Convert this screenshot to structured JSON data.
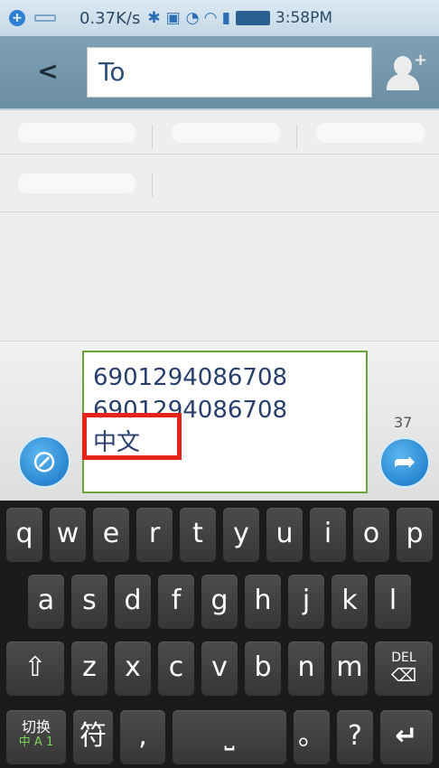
{
  "status_bar": {
    "speed": "0.37K/s",
    "time": "3:58PM",
    "icons": [
      "plus-circle-icon",
      "keyboard-icon",
      "bluetooth-icon",
      "vibrate-icon",
      "sync-icon",
      "wifi-icon",
      "signal-icon",
      "battery-icon"
    ]
  },
  "header": {
    "back_label": "<",
    "to_placeholder": "To",
    "add_contact_icon": "add-contact-icon"
  },
  "compose": {
    "message_lines": [
      "6901294086708",
      "6901294086708",
      "中文"
    ],
    "char_counter": "37",
    "attach_icon": "paperclip-icon",
    "send_icon": "send-icon"
  },
  "keyboard": {
    "row1": [
      "q",
      "w",
      "e",
      "r",
      "t",
      "y",
      "u",
      "i",
      "o",
      "p"
    ],
    "row2": [
      "a",
      "s",
      "d",
      "f",
      "g",
      "h",
      "j",
      "k",
      "l"
    ],
    "row3_letters": [
      "z",
      "x",
      "c",
      "v",
      "b",
      "n",
      "m"
    ],
    "shift_label": "⇧",
    "del_label": "DEL",
    "switch_label_top": "切换",
    "switch_label_bottom": "中 A 1",
    "symbol_label": "符",
    "comma_label": ",",
    "space_label": "⎵",
    "period_label": "。",
    "question_label": "?",
    "enter_label": "↵"
  },
  "colors": {
    "accent": "#1572c2",
    "highlight": "#e3241b",
    "input_border": "#6aa33a"
  }
}
